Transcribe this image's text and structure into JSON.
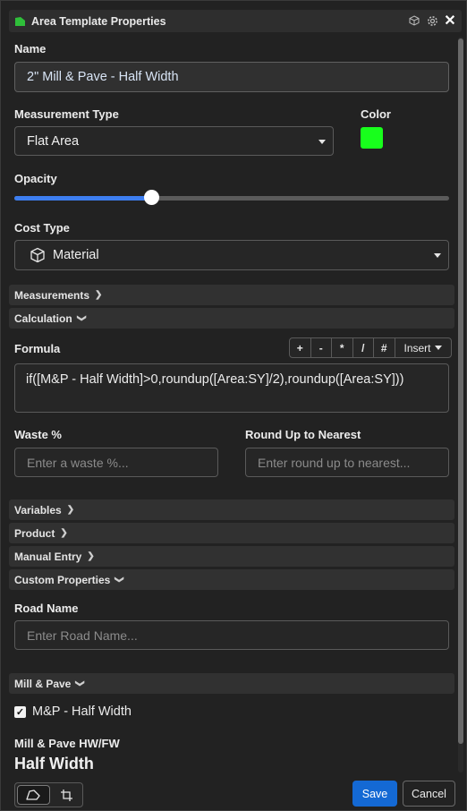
{
  "window": {
    "title": "Area Template Properties",
    "icons": [
      "area-icon",
      "cube-icon",
      "gear-icon",
      "close-icon"
    ]
  },
  "name": {
    "label": "Name",
    "value": "2\" Mill & Pave - Half Width"
  },
  "measurement_type": {
    "label": "Measurement Type",
    "value": "Flat Area"
  },
  "color": {
    "label": "Color",
    "value": "#18ff1c"
  },
  "opacity": {
    "label": "Opacity",
    "level": 0.315
  },
  "cost_type": {
    "label": "Cost Type",
    "value": "Material",
    "icon": "cube-icon"
  },
  "sections": {
    "measurements": "Measurements",
    "calculation": "Calculation",
    "variables": "Variables",
    "product": "Product",
    "manual_entry": "Manual Entry",
    "custom_properties": "Custom Properties",
    "mill_pave": "Mill & Pave"
  },
  "formula": {
    "label": "Formula",
    "operators": [
      "+",
      "-",
      "*",
      "/",
      "#"
    ],
    "insert_label": "Insert",
    "value": "if([M&P - Half Width]>0,roundup([Area:SY]/2),roundup([Area:SY]))"
  },
  "waste": {
    "label": "Waste %",
    "placeholder": "Enter a waste %..."
  },
  "round_up": {
    "label": "Round Up to Nearest",
    "placeholder": "Enter round up to nearest..."
  },
  "road_name": {
    "label": "Road Name",
    "placeholder": "Enter Road Name..."
  },
  "mp_half_width": {
    "label": "M&P - Half Width",
    "checked": true
  },
  "mill_pave_hwfw": {
    "label": "Mill & Pave HW/FW",
    "value": "Half Width"
  },
  "footer": {
    "save_label": "Save",
    "cancel_label": "Cancel",
    "tools": [
      "polygon-tool-icon",
      "crop-tool-icon"
    ]
  }
}
